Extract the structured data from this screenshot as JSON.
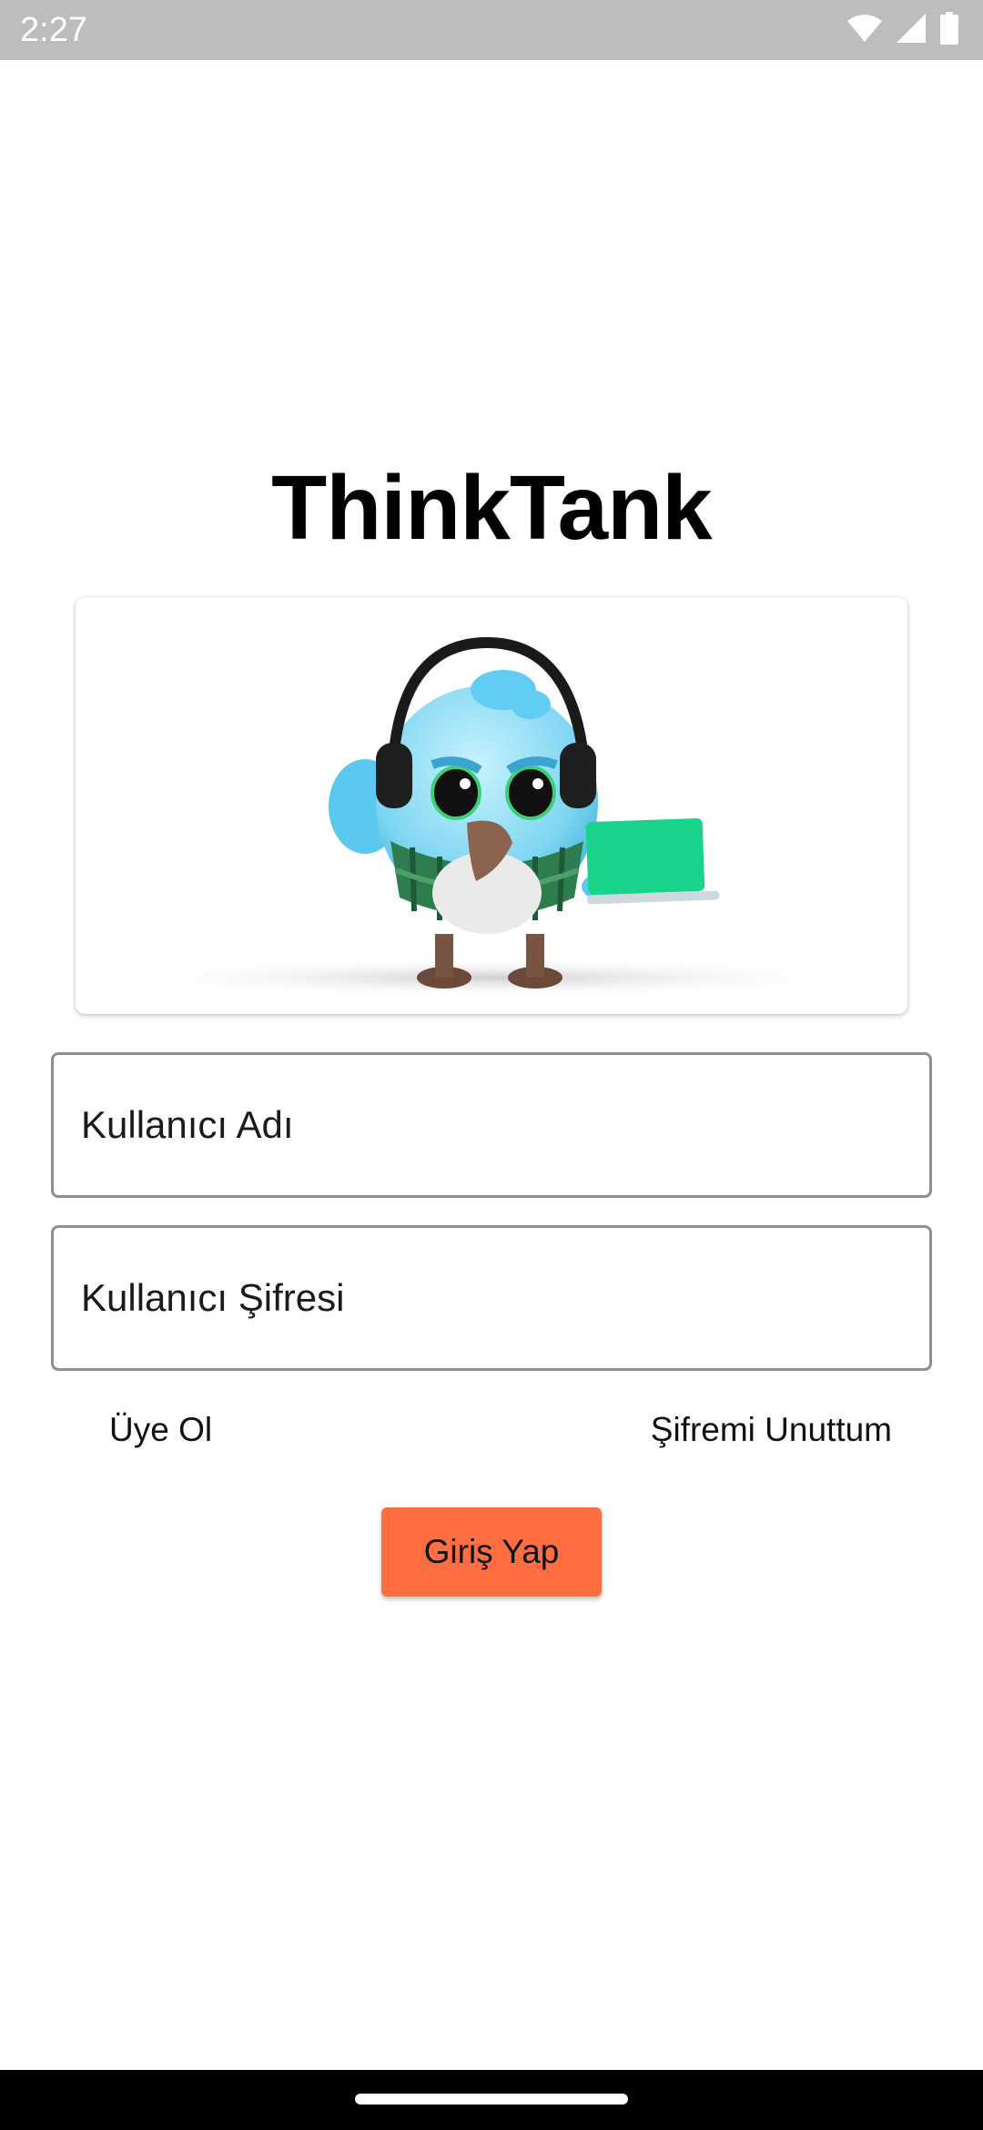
{
  "status_bar": {
    "time": "2:27",
    "icons": [
      "wifi-icon",
      "cellular-signal-icon",
      "battery-icon"
    ]
  },
  "app": {
    "title": "ThinkTank"
  },
  "mascot": {
    "icon": "bird-mascot-with-headphones-and-laptop"
  },
  "form": {
    "username_placeholder": "Kullanıcı Adı",
    "password_placeholder": "Kullanıcı Şifresi",
    "signup_link": "Üye Ol",
    "forgot_password_link": "Şifremi Unuttum",
    "login_button": "Giriş Yap"
  },
  "colors": {
    "status_bar": "#bdbdbd",
    "login_button": "#ff6e40",
    "nav_bar": "#000000"
  }
}
